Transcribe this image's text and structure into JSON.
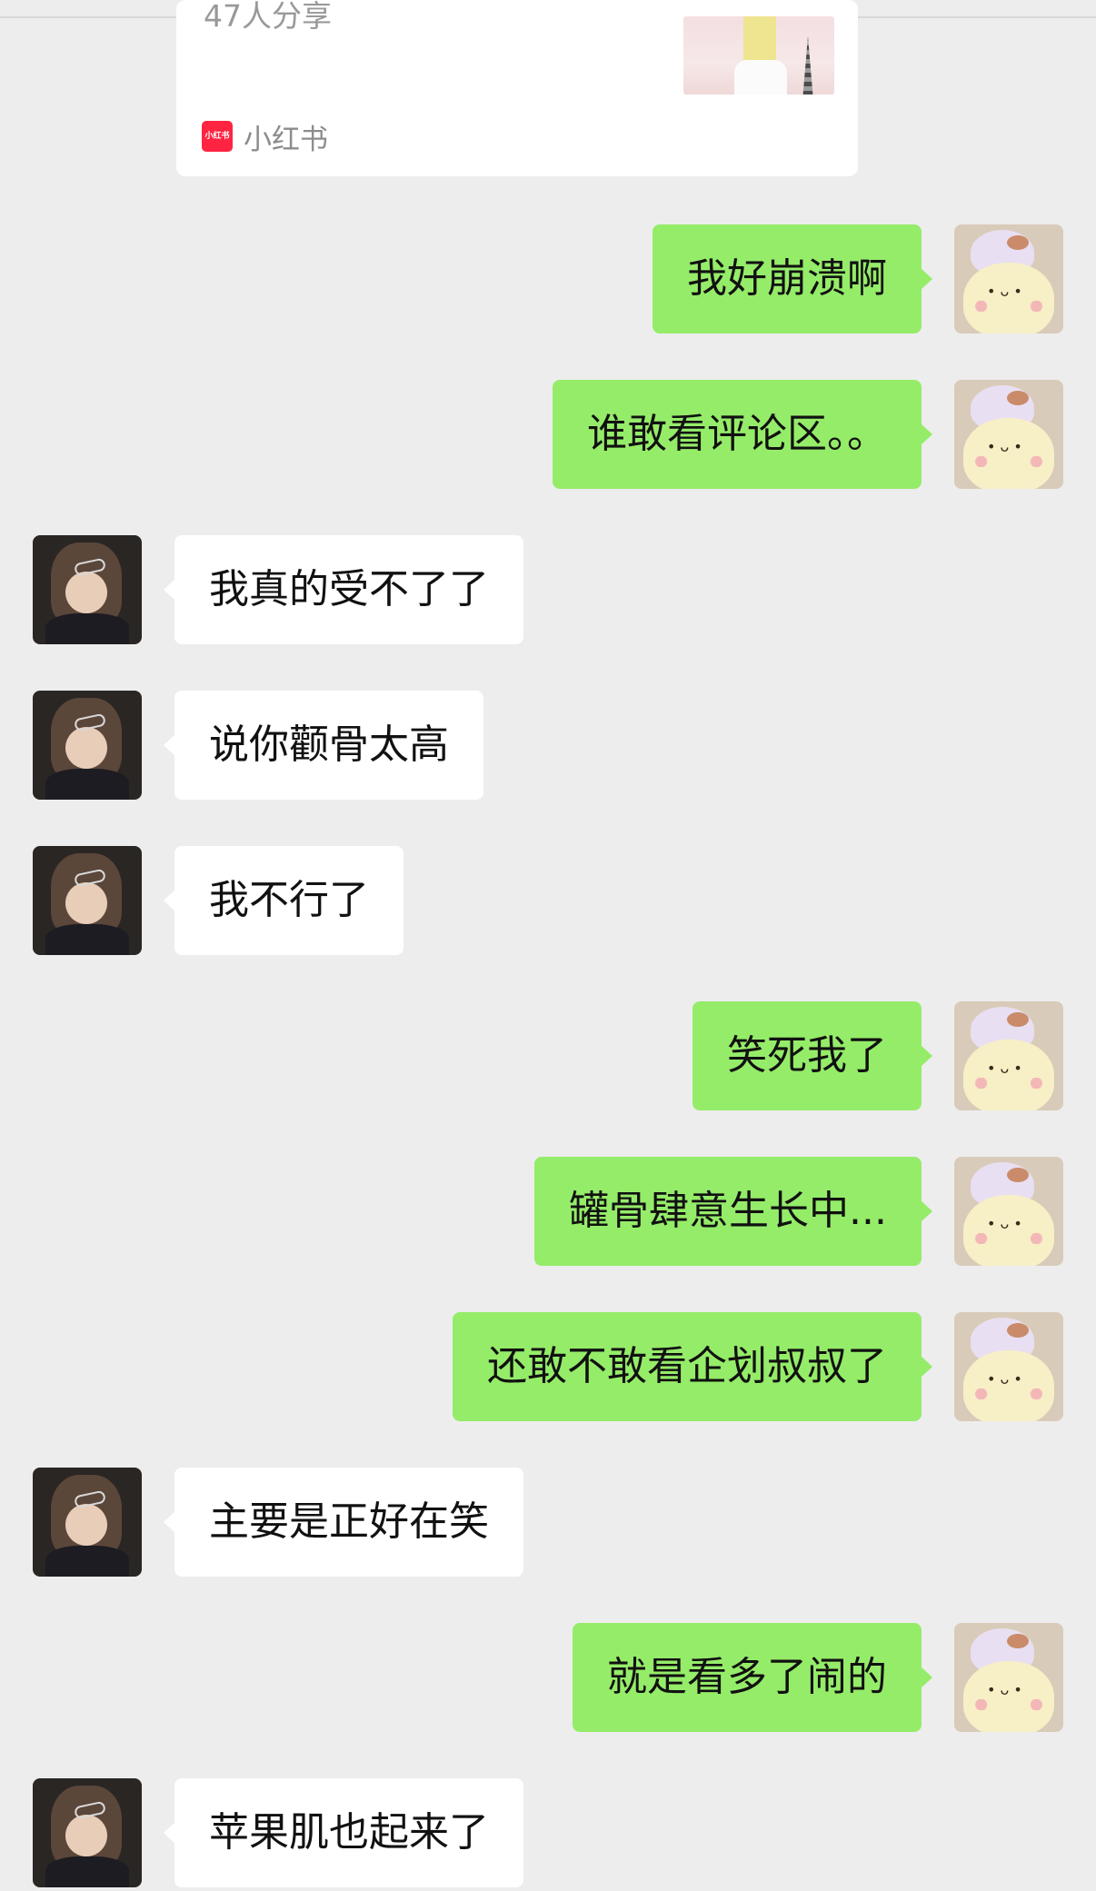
{
  "shared_card": {
    "share_count": "47人分享",
    "source_logo_text": "小红书",
    "source_name": "小红书"
  },
  "messages": [
    {
      "from": "me",
      "text": "我好崩溃啊"
    },
    {
      "from": "me",
      "text": "谁敢看评论区。。"
    },
    {
      "from": "other",
      "text": "我真的受不了了"
    },
    {
      "from": "other",
      "text": "说你颧骨太高"
    },
    {
      "from": "other",
      "text": "我不行了"
    },
    {
      "from": "me",
      "text": "笑死我了"
    },
    {
      "from": "me",
      "text": "罐骨肆意生长中..."
    },
    {
      "from": "me",
      "text": "还敢不敢看企划叔叔了"
    },
    {
      "from": "other",
      "text": "主要是正好在笑"
    },
    {
      "from": "me",
      "text": "就是看多了闹的"
    },
    {
      "from": "other",
      "text": "苹果肌也起来了"
    }
  ],
  "colors": {
    "background": "#ededed",
    "my_bubble": "#95ec69",
    "other_bubble": "#ffffff",
    "source_logo": "#ff2442"
  }
}
